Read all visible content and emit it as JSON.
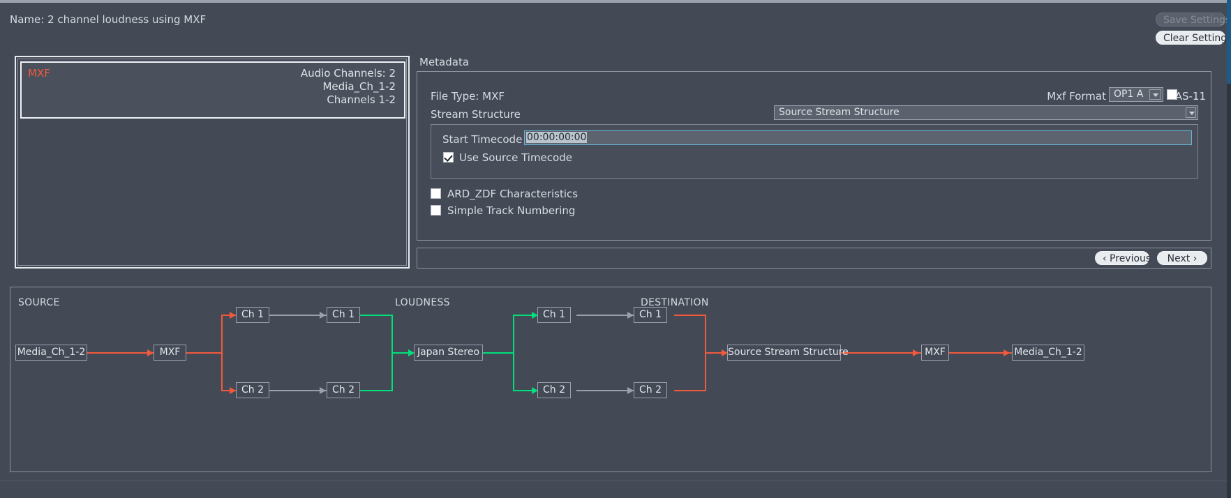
{
  "header": {
    "name_label": "Name: 2 channel loudness using MXF",
    "save_settings": "Save Settings",
    "clear_settings": "Clear Settings"
  },
  "file_list": {
    "entry": {
      "title": "MXF",
      "audio_channels": "Audio Channels: 2",
      "media_channels": "Media_Ch_1-2",
      "channels": "Channels 1-2"
    }
  },
  "metadata": {
    "group_title": "Metadata",
    "file_type": "File Type: MXF",
    "mxf_format_label": "Mxf Format",
    "mxf_format_value": "OP1 A",
    "as11_label": "AS-11",
    "as11_checked": false,
    "stream_structure_label": "Stream Structure",
    "stream_structure_value": "Source Stream Structure",
    "start_timecode_label": "Start Timecode",
    "start_timecode_value": "00:00:00:00",
    "use_source_timecode_label": "Use Source Timecode",
    "use_source_timecode_checked": true,
    "ard_zdf_label": "ARD_ZDF Characteristics",
    "ard_zdf_checked": false,
    "simple_track_label": "Simple Track Numbering",
    "simple_track_checked": false
  },
  "nav": {
    "previous": "‹ Previous",
    "next": "Next ›"
  },
  "diagram": {
    "headers": {
      "source": "SOURCE",
      "loudness": "LOUDNESS",
      "destination": "DESTINATION"
    },
    "nodes": {
      "src_media": "Media_Ch_1-2",
      "src_mxf": "MXF",
      "src_ch1": "Ch 1",
      "src_ch2": "Ch 2",
      "loud_in_ch1": "Ch 1",
      "loud_in_ch2": "Ch 2",
      "loud_preset": "Japan Stereo",
      "loud_out_ch1": "Ch 1",
      "loud_out_ch2": "Ch 2",
      "dest_ch1": "Ch 1",
      "dest_ch2": "Ch 2",
      "dest_stream": "Source Stream Structure",
      "dest_mxf": "MXF",
      "dest_media": "Media_Ch_1-2"
    },
    "colors": {
      "source_link": "#f4593c",
      "loudness_link": "#00e07a",
      "neutral_link": "#9aa1ab"
    }
  }
}
